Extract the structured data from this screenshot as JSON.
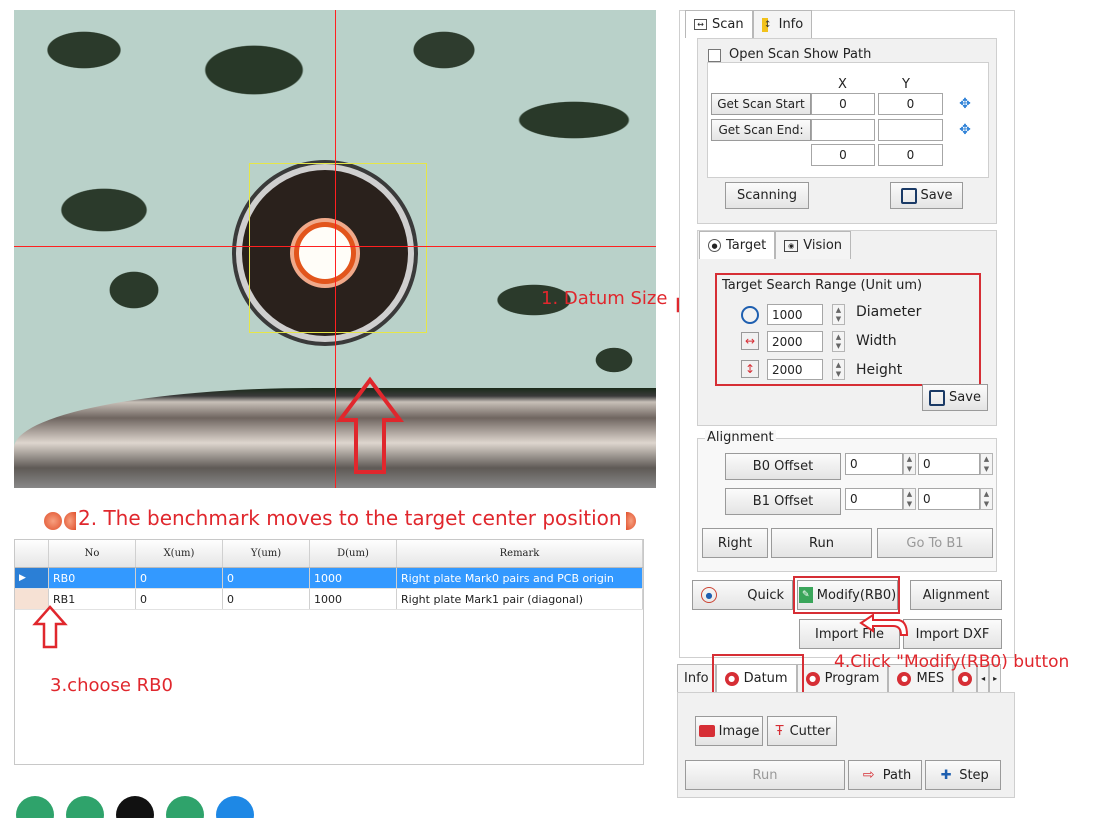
{
  "annotations": {
    "datum_size": "1. Datum Size",
    "benchmark_moves": "2. The benchmark moves to the target center position",
    "choose_rb0": "3.choose RB0",
    "click_modify": "4.Click \"Modify(RB0) button"
  },
  "grid": {
    "columns": [
      "No",
      "X(um)",
      "Y(um)",
      "D(um)",
      "Remark"
    ],
    "rows": [
      {
        "no": "RB0",
        "x": "0",
        "y": "0",
        "d": "1000",
        "remark": "Right plate Mark0 pairs and PCB origin",
        "selected": true
      },
      {
        "no": "RB1",
        "x": "0",
        "y": "0",
        "d": "1000",
        "remark": "Right plate Mark1 pair (diagonal)",
        "selected": false
      }
    ]
  },
  "scan": {
    "tabs": [
      "Scan",
      "Info"
    ],
    "open_scan_show_path": "Open Scan Show Path",
    "col_x": "X",
    "col_y": "Y",
    "get_scan_start": "Get Scan Start",
    "get_scan_end": "Get Scan End:",
    "start_x": "0",
    "start_y": "0",
    "end_x": "",
    "end_y": "",
    "size_x": "0",
    "size_y": "0",
    "scanning": "Scanning",
    "save": "Save"
  },
  "target": {
    "tabs": [
      "Target",
      "Vision"
    ],
    "range_title": "Target Search Range (Unit um)",
    "diameter_value": "1000",
    "diameter_label": "Diameter",
    "width_value": "2000",
    "width_label": "Width",
    "height_value": "2000",
    "height_label": "Height",
    "save": "Save"
  },
  "alignment": {
    "title": "Alignment",
    "b0_offset": "B0 Offset",
    "b0_x": "0",
    "b0_y": "0",
    "b1_offset": "B1 Offset",
    "b1_x": "0",
    "b1_y": "0",
    "right": "Right",
    "run": "Run",
    "go_to_b1": "Go To B1"
  },
  "actions": {
    "quick": "Quick",
    "modify": "Modify(RB0)",
    "alignment": "Alignment",
    "import_file": "Import File",
    "import_dxf": "Import DXF"
  },
  "bottom_tabs": [
    "Info",
    "Datum",
    "Program",
    "MES"
  ],
  "bottom": {
    "image": "Image",
    "cutter": "Cutter",
    "run": "Run",
    "path": "Path",
    "step": "Step"
  },
  "colors": {
    "annotation_red": "#d62e35",
    "selection_blue": "#3399ff",
    "crosshair_red": "#ff2020",
    "dock_green": "#2fa36b",
    "dock_blue": "#1e88e5"
  }
}
